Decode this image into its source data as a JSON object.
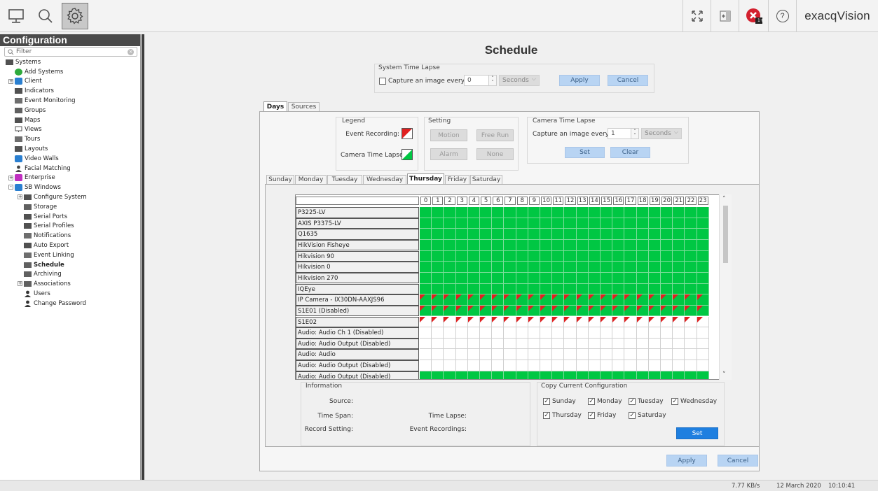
{
  "toolbar": {
    "left_icons": [
      "monitor-icon",
      "search-icon",
      "gear-icon"
    ],
    "right_icons": [
      "fullscreen-icon",
      "exit-icon",
      "alert-icon",
      "help-icon"
    ],
    "alert_badge": "1+",
    "help_glyph": "?",
    "brand": "exacqVision"
  },
  "sidebar": {
    "title": "Configuration",
    "filter_placeholder": "Filter",
    "tree": [
      {
        "label": "Systems",
        "icon": "server-icon"
      },
      {
        "label": "Add Systems",
        "icon": "add-icon"
      },
      {
        "label": "Client",
        "icon": "client-icon"
      },
      {
        "label": "Indicators",
        "icon": "flag-icon"
      },
      {
        "label": "Event Monitoring",
        "icon": "link-icon"
      },
      {
        "label": "Groups",
        "icon": "groups-icon"
      },
      {
        "label": "Maps",
        "icon": "map-icon"
      },
      {
        "label": "Views",
        "icon": "monitor-icon"
      },
      {
        "label": "Tours",
        "icon": "tour-icon"
      },
      {
        "label": "Layouts",
        "icon": "layout-icon"
      },
      {
        "label": "Video Walls",
        "icon": "videowall-icon"
      },
      {
        "label": "Facial Matching",
        "icon": "person-icon"
      },
      {
        "label": "Enterprise",
        "icon": "enterprise-icon"
      },
      {
        "label": "SB Windows",
        "icon": "gear-blue-icon"
      },
      {
        "label": "Configure System",
        "icon": "server-icon"
      },
      {
        "label": "Storage",
        "icon": "storage-icon"
      },
      {
        "label": "Serial Ports",
        "icon": "serial-icon"
      },
      {
        "label": "Serial Profiles",
        "icon": "profile-icon"
      },
      {
        "label": "Notifications",
        "icon": "notification-icon"
      },
      {
        "label": "Auto Export",
        "icon": "download-icon"
      },
      {
        "label": "Event Linking",
        "icon": "linking-icon"
      },
      {
        "label": "Schedule",
        "icon": "calendar-icon"
      },
      {
        "label": "Archiving",
        "icon": "archive-icon"
      },
      {
        "label": "Associations",
        "icon": "associations-icon"
      },
      {
        "label": "Users",
        "icon": "user-icon"
      },
      {
        "label": "Change Password",
        "icon": "user-icon"
      }
    ]
  },
  "page": {
    "title": "Schedule"
  },
  "system_time_lapse": {
    "legend": "System Time Lapse",
    "capture_label": "Capture an image every:",
    "value": "0",
    "unit": "Seconds",
    "apply": "Apply",
    "cancel": "Cancel"
  },
  "top_tabs": [
    "Days",
    "Sources"
  ],
  "legend": {
    "title": "Legend",
    "event_recording": "Event Recording:",
    "camera_time_lapse": "Camera Time Lapse:"
  },
  "setting": {
    "title": "Setting",
    "motion": "Motion",
    "free_run": "Free Run",
    "alarm": "Alarm",
    "none": "None"
  },
  "camera_time_lapse": {
    "title": "Camera Time Lapse",
    "capture_label": "Capture an image every",
    "value": "1",
    "unit": "Seconds",
    "set": "Set",
    "clear": "Clear"
  },
  "weekday_tabs": [
    "Sunday",
    "Monday",
    "Tuesday",
    "Wednesday",
    "Thursday",
    "Friday",
    "Saturday"
  ],
  "active_weekday": "Thursday",
  "grid": {
    "hours": [
      "0",
      "1",
      "2",
      "3",
      "4",
      "5",
      "6",
      "7",
      "8",
      "9",
      "10",
      "11",
      "12",
      "13",
      "14",
      "15",
      "16",
      "17",
      "18",
      "19",
      "20",
      "21",
      "22",
      "23"
    ],
    "rows": [
      {
        "name": "P3225-LV",
        "mode": "green"
      },
      {
        "name": "AXIS P3375-LV",
        "mode": "green"
      },
      {
        "name": "Q1635",
        "mode": "green"
      },
      {
        "name": "HikVision Fisheye",
        "mode": "green"
      },
      {
        "name": "Hikvision 90",
        "mode": "green"
      },
      {
        "name": "Hikvision 0",
        "mode": "green"
      },
      {
        "name": "Hikvision 270",
        "mode": "green"
      },
      {
        "name": "IQEye",
        "mode": "green"
      },
      {
        "name": "IP Camera - IX30DN-AAXJS96",
        "mode": "green-event"
      },
      {
        "name": "S1E01 (Disabled)",
        "mode": "green-event"
      },
      {
        "name": "S1E02",
        "mode": "white-event"
      },
      {
        "name": "Audio: Audio Ch 1 (Disabled)",
        "mode": "white"
      },
      {
        "name": "Audio: Audio Output (Disabled)",
        "mode": "white"
      },
      {
        "name": "Audio: Audio",
        "mode": "white"
      },
      {
        "name": "Audio: Audio Output (Disabled)",
        "mode": "white"
      },
      {
        "name": "Audio: Audio Output (Disabled)",
        "mode": "green"
      }
    ]
  },
  "information": {
    "title": "Information",
    "source": "Source:",
    "time_span": "Time Span:",
    "time_lapse": "Time Lapse:",
    "record_setting": "Record Setting:",
    "event_recordings": "Event Recordings:"
  },
  "copy_config": {
    "title": "Copy Current Configuration",
    "days": [
      "Sunday",
      "Monday",
      "Tuesday",
      "Wednesday",
      "Thursday",
      "Friday",
      "Saturday"
    ],
    "set": "Set"
  },
  "footer": {
    "apply": "Apply",
    "cancel": "Cancel"
  },
  "status": {
    "rate": "7.77 KB/s",
    "date": "12 March 2020",
    "time": "10:10:41"
  },
  "colors": {
    "schedule_green": "#00c743",
    "event_red": "#e02020",
    "button_blue": "#b8d4f3",
    "set_blue": "#1e7fe0"
  }
}
